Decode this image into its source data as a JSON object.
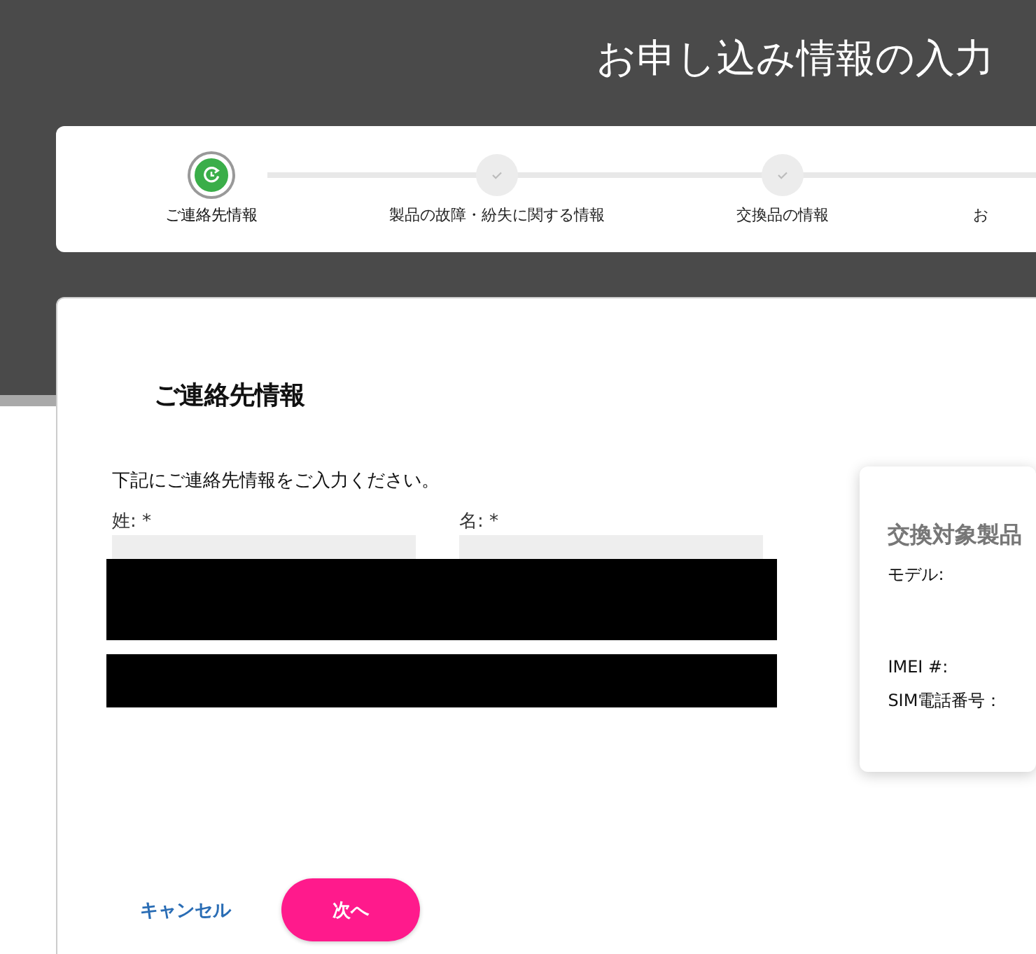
{
  "page_title": "お申し込み情報の入力",
  "steps": [
    {
      "label": "ご連絡先情報",
      "selected": true
    },
    {
      "label": "製品の故障・紛失に関する情報",
      "selected": false
    },
    {
      "label": "交換品の情報",
      "selected": false
    },
    {
      "label": "お",
      "selected": false
    }
  ],
  "section_title": "ご連絡先情報",
  "intro": "下記にご連絡先情報をご入力ください。",
  "fields": [
    {
      "label": "姓: *"
    },
    {
      "label": "名: *"
    }
  ],
  "redactions": [
    {
      "kind": "tall"
    },
    {
      "kind": "short"
    }
  ],
  "summary": {
    "title": "交換対象製品",
    "rows": [
      {
        "label": "モデル:",
        "kind": "tall"
      },
      {
        "label": "IMEI #:",
        "kind": "line"
      },
      {
        "label": "SIM電話番号：",
        "kind": "line"
      }
    ]
  },
  "buttons": [
    {
      "label": "キャンセル",
      "kind": "link"
    },
    {
      "label": "次へ",
      "kind": "primary"
    }
  ]
}
